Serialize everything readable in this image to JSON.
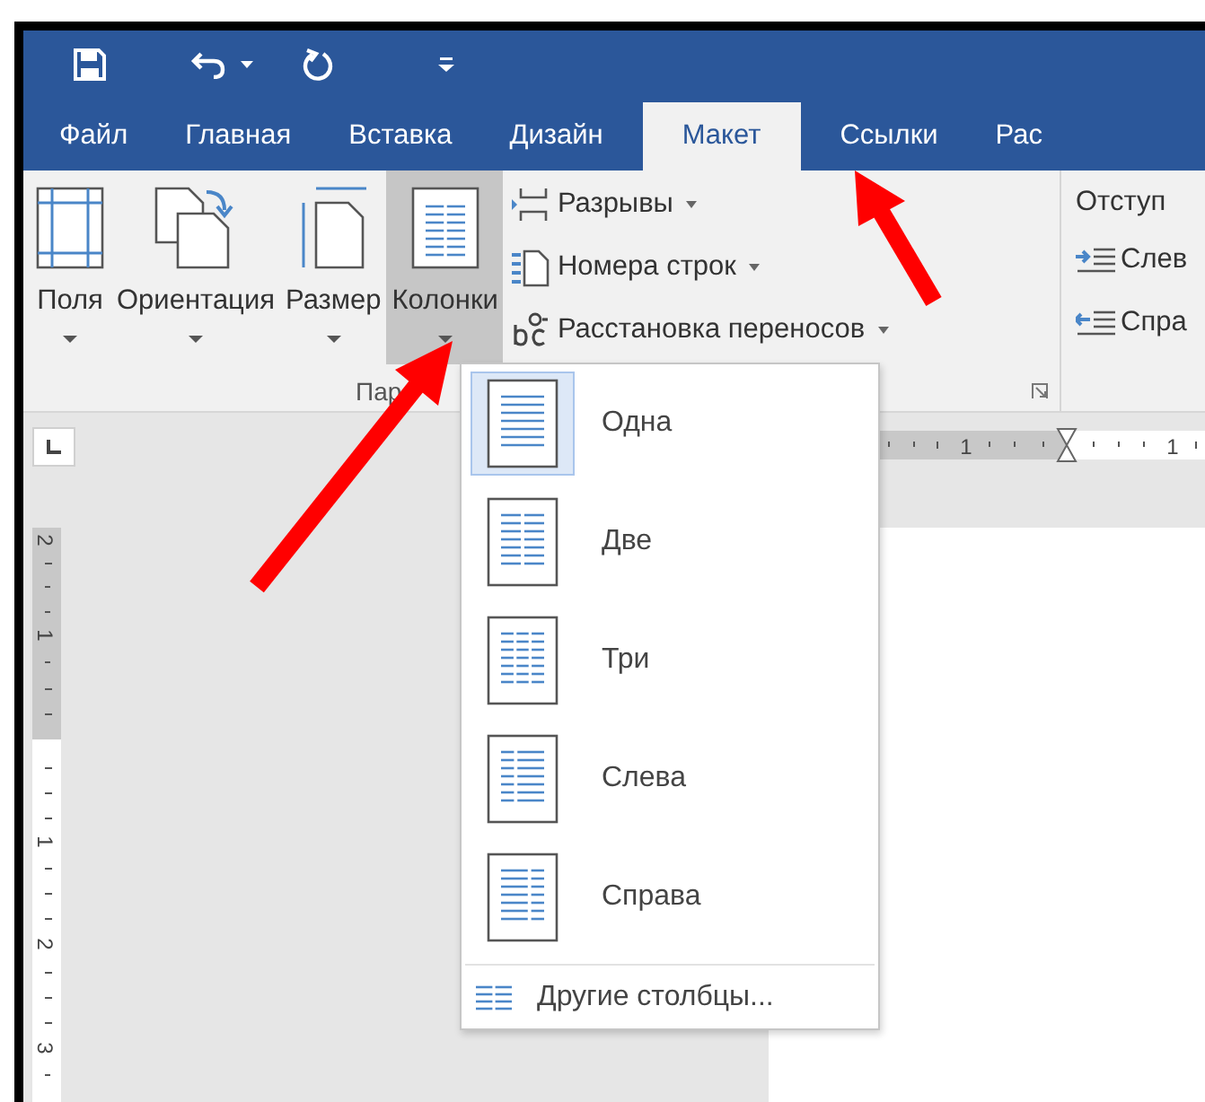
{
  "tabs": [
    {
      "label": "Файл",
      "selected": false
    },
    {
      "label": "Главная",
      "selected": false
    },
    {
      "label": "Вставка",
      "selected": false
    },
    {
      "label": "Дизайн",
      "selected": false
    },
    {
      "label": "Макет",
      "selected": true
    },
    {
      "label": "Ссылки",
      "selected": false
    },
    {
      "label": "Рас",
      "selected": false
    }
  ],
  "ribbon": {
    "page_setup": {
      "label": "Пар",
      "large_buttons": [
        {
          "label": "Поля",
          "pressed": false
        },
        {
          "label": "Ориентация",
          "pressed": false
        },
        {
          "label": "Размер",
          "pressed": false
        },
        {
          "label": "Колонки",
          "pressed": true
        }
      ],
      "small_buttons": [
        {
          "label": "Разрывы"
        },
        {
          "label": "Номера строк"
        },
        {
          "label": "Расстановка переносов"
        }
      ]
    },
    "paragraph": {
      "heading": "Отступ",
      "items": [
        {
          "label": "Слев"
        },
        {
          "label": "Спра"
        }
      ]
    }
  },
  "ruler": {
    "horizontal_marks": [
      "1",
      "1"
    ],
    "vertical_marks": [
      "2",
      "1",
      "1",
      "2",
      "3"
    ]
  },
  "columns_menu": {
    "items": [
      {
        "label": "Одна",
        "selected": true
      },
      {
        "label": "Две",
        "selected": false
      },
      {
        "label": "Три",
        "selected": false
      },
      {
        "label": "Слева",
        "selected": false
      },
      {
        "label": "Справа",
        "selected": false
      }
    ],
    "more": "Другие столбцы..."
  }
}
